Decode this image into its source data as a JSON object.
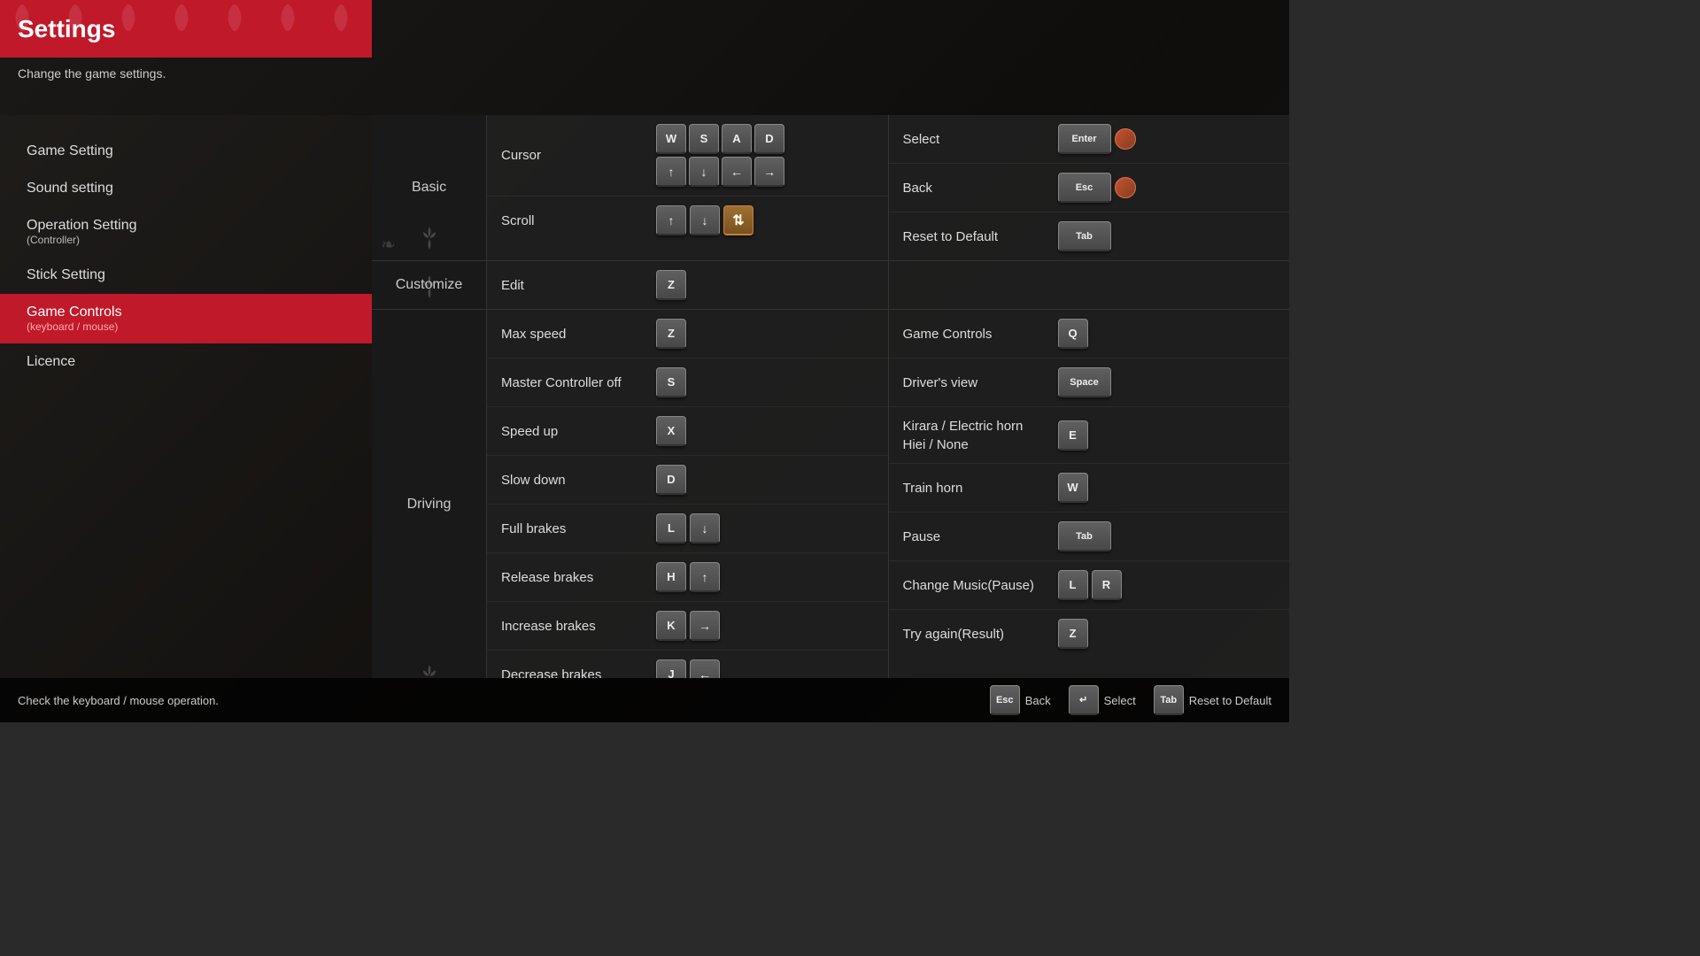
{
  "header": {
    "title": "Settings",
    "subtitle": "Change the game settings."
  },
  "sidebar": {
    "items": [
      {
        "id": "game-setting",
        "label": "Game Setting",
        "sub": "",
        "active": false
      },
      {
        "id": "sound-setting",
        "label": "Sound setting",
        "sub": "",
        "active": false
      },
      {
        "id": "operation-setting",
        "label": "Operation Setting",
        "sub": "(Controller)",
        "active": false
      },
      {
        "id": "stick-setting",
        "label": "Stick Setting",
        "sub": "",
        "active": false
      },
      {
        "id": "game-controls",
        "label": "Game Controls",
        "sub": "(keyboard / mouse)",
        "active": true
      },
      {
        "id": "licence",
        "label": "Licence",
        "sub": "",
        "active": false
      }
    ]
  },
  "sections": {
    "basic": {
      "label": "Basic",
      "rows_left": [
        {
          "name": "Cursor",
          "keys": [
            [
              "W",
              "S",
              "A",
              "D"
            ],
            [
              "↑",
              "↓",
              "←",
              "→"
            ]
          ]
        },
        {
          "name": "Scroll",
          "keys": [
            [
              "↑",
              "↓",
              "🖱"
            ]
          ]
        }
      ],
      "rows_right": [
        {
          "name": "Select",
          "keys": [
            "Enter"
          ],
          "icon": true
        },
        {
          "name": "Back",
          "keys": [
            "Esc"
          ],
          "icon": true
        },
        {
          "name": "Reset to Default",
          "keys": [
            "Tab"
          ]
        }
      ]
    },
    "customize": {
      "label": "Customize",
      "rows_left": [
        {
          "name": "Edit",
          "keys": [
            "Z"
          ]
        }
      ],
      "rows_right": []
    },
    "driving": {
      "label": "Driving",
      "rows_left": [
        {
          "name": "Max speed",
          "keys": [
            "Z"
          ]
        },
        {
          "name": "Master Controller off",
          "keys": [
            "S"
          ]
        },
        {
          "name": "Speed up",
          "keys": [
            "X"
          ]
        },
        {
          "name": "Slow down",
          "keys": [
            "D"
          ]
        },
        {
          "name": "Full brakes",
          "keys": [
            "L",
            "↓"
          ]
        },
        {
          "name": "Release brakes",
          "keys": [
            "H",
            "↑"
          ]
        },
        {
          "name": "Increase brakes",
          "keys": [
            "K",
            "→"
          ]
        },
        {
          "name": "Decrease brakes",
          "keys": [
            "J",
            "←"
          ]
        }
      ],
      "rows_right": [
        {
          "name": "Game Controls",
          "keys": [
            "Q"
          ]
        },
        {
          "name": "Driver's view",
          "keys": [
            "Space"
          ]
        },
        {
          "name": "Kirara / Electric horn\nHiei / None",
          "keys": [
            "E"
          ]
        },
        {
          "name": "Train horn",
          "keys": [
            "W"
          ]
        },
        {
          "name": "Pause",
          "keys": [
            "Tab"
          ]
        },
        {
          "name": "Change Music(Pause)",
          "keys": [
            "L",
            "R"
          ]
        },
        {
          "name": "Try again(Result)",
          "keys": [
            "Z"
          ]
        }
      ]
    }
  },
  "status_bar": {
    "text": "Check the keyboard / mouse operation.",
    "actions": [
      {
        "key": "Esc",
        "label": "Back"
      },
      {
        "key": "↵",
        "label": "Select"
      },
      {
        "key": "Tab",
        "label": "Reset to Default"
      }
    ]
  }
}
